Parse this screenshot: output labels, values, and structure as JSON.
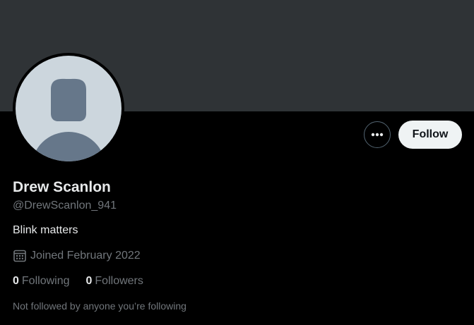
{
  "profile": {
    "display_name": "Drew Scanlon",
    "handle": "@DrewScanlon_941",
    "bio": "Blink matters",
    "joined": "Joined February 2022",
    "following_count": "0",
    "following_label": "Following",
    "followers_count": "0",
    "followers_label": "Followers",
    "follow_note": "Not followed by anyone you’re following"
  },
  "actions": {
    "follow_label": "Follow",
    "more_icon": "more-horizontal-icon"
  },
  "icons": {
    "calendar": "calendar-icon",
    "avatar_placeholder": "default-avatar-icon"
  },
  "colors": {
    "background": "#000000",
    "banner": "#2f3336",
    "avatar_bg": "#ccd6dd",
    "avatar_silhouette": "#66778a",
    "primary_text": "#e7e9ea",
    "secondary_text": "#71767b",
    "follow_button_bg": "#eff3f4",
    "follow_button_text": "#0f1419"
  }
}
